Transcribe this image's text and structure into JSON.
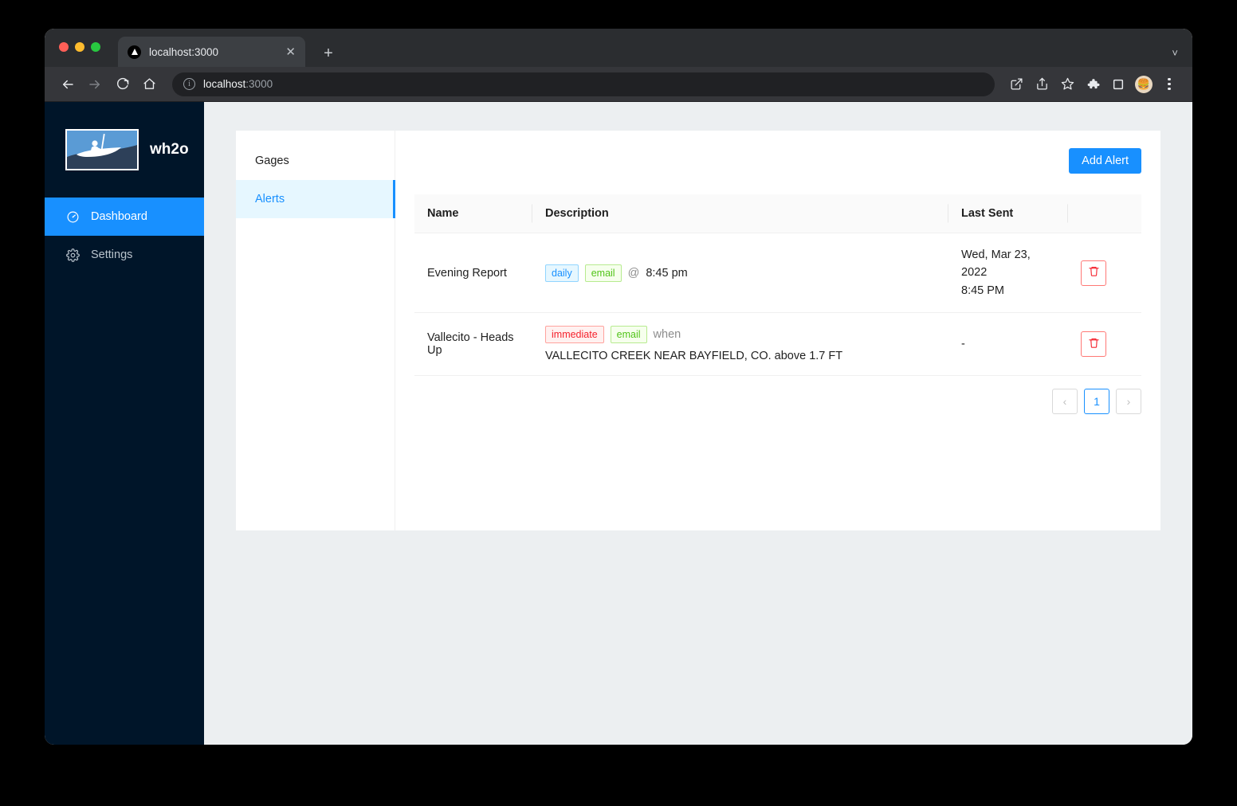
{
  "browser": {
    "tab": {
      "title": "localhost:3000",
      "favicon": "nextjs-triangle-icon",
      "close": "✕"
    },
    "new_tab": "+",
    "tabstrip_menu": "˅",
    "back": "←",
    "forward": "→",
    "reload": "⟳",
    "home": "⌂",
    "omnibox": {
      "info": "i",
      "host": "localhost",
      "port": ":3000"
    },
    "toolbar_icons": [
      "open-in-new-icon",
      "share-icon",
      "bookmark-star-icon",
      "extensions-puzzle-icon",
      "side-panel-icon"
    ],
    "avatar": "🍔"
  },
  "sidebar": {
    "brand": "wh2o",
    "logo": "kayaker-logo",
    "items": [
      {
        "label": "Dashboard",
        "icon": "dashboard-gauge-icon",
        "active": true
      },
      {
        "label": "Settings",
        "icon": "gear-icon",
        "active": false
      }
    ]
  },
  "tabs": [
    {
      "label": "Gages",
      "active": false
    },
    {
      "label": "Alerts",
      "active": true
    }
  ],
  "panel": {
    "add_button": "Add Alert",
    "columns": [
      "Name",
      "Description",
      "Last Sent",
      ""
    ],
    "rows": [
      {
        "name": "Evening Report",
        "tags": [
          {
            "text": "daily",
            "style": "blue"
          },
          {
            "text": "email",
            "style": "green"
          }
        ],
        "prefix": "@",
        "detail": "8:45 pm",
        "last_sent_line1": "Wed, Mar 23, 2022",
        "last_sent_line2": "8:45 PM",
        "delete_icon": "trash-icon"
      },
      {
        "name": "Vallecito - Heads Up",
        "tags": [
          {
            "text": "immediate",
            "style": "red"
          },
          {
            "text": "email",
            "style": "green"
          }
        ],
        "prefix": "when",
        "detail": "VALLECITO CREEK NEAR BAYFIELD, CO. above 1.7 FT",
        "last_sent_line1": "-",
        "last_sent_line2": "",
        "delete_icon": "trash-icon"
      }
    ],
    "pagination": {
      "prev": "‹",
      "page": "1",
      "next": "›"
    }
  },
  "colors": {
    "accent": "#1890ff",
    "sidebar": "#001529",
    "danger": "#f5222d",
    "success": "#52c41a",
    "page_bg": "#eceff1"
  }
}
